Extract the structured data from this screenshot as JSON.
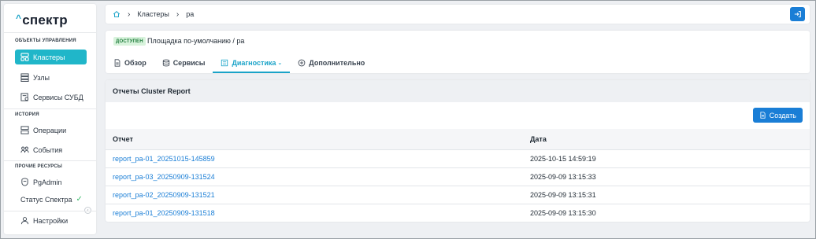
{
  "brand": {
    "logo_text": "спектр",
    "logo_caret": "^"
  },
  "sidebar": {
    "sections": [
      {
        "title": "ОБЪЕКТЫ УПРАВЛЕНИЯ"
      },
      {
        "title": "ИСТОРИЯ"
      },
      {
        "title": "ПРОЧИЕ РЕСУРСЫ"
      }
    ],
    "items": [
      {
        "label": "Кластеры",
        "icon": "cluster-icon",
        "active": true
      },
      {
        "label": "Узлы",
        "icon": "nodes-icon"
      },
      {
        "label": "Сервисы СУБД",
        "icon": "db-service-icon"
      },
      {
        "label": "Операции",
        "icon": "operations-icon"
      },
      {
        "label": "События",
        "icon": "events-icon"
      },
      {
        "label": "PgAdmin",
        "icon": "pgadmin-icon"
      },
      {
        "label": "Статус Спектра",
        "icon": "check-icon"
      }
    ],
    "settings_label": "Настройки"
  },
  "breadcrumb": {
    "items": [
      "Кластеры",
      "pa"
    ]
  },
  "header": {
    "status_badge": "ДОСТУПЕН",
    "path": "Площадка по-умолчанию / pa",
    "tabs": [
      {
        "label": "Обзор",
        "icon": "document-icon"
      },
      {
        "label": "Сервисы",
        "icon": "database-icon"
      },
      {
        "label": "Диагностика",
        "icon": "list-icon",
        "active": true
      },
      {
        "label": "Дополнительно",
        "icon": "plus-circle-icon"
      }
    ]
  },
  "reports": {
    "title": "Отчеты Cluster Report",
    "create_label": "Создать",
    "columns": [
      "Отчет",
      "Дата"
    ],
    "rows": [
      {
        "name": "report_pa-01_20251015-145859",
        "date": "2025-10-15 14:59:19"
      },
      {
        "name": "report_pa-03_20250909-131524",
        "date": "2025-09-09 13:15:33"
      },
      {
        "name": "report_pa-02_20250909-131521",
        "date": "2025-09-09 13:15:31"
      },
      {
        "name": "report_pa-01_20250909-131518",
        "date": "2025-09-09 13:15:30"
      }
    ]
  },
  "colors": {
    "accent": "#20b6c9",
    "primary": "#1a7ed6",
    "status_ok": "#3cbc6c"
  }
}
